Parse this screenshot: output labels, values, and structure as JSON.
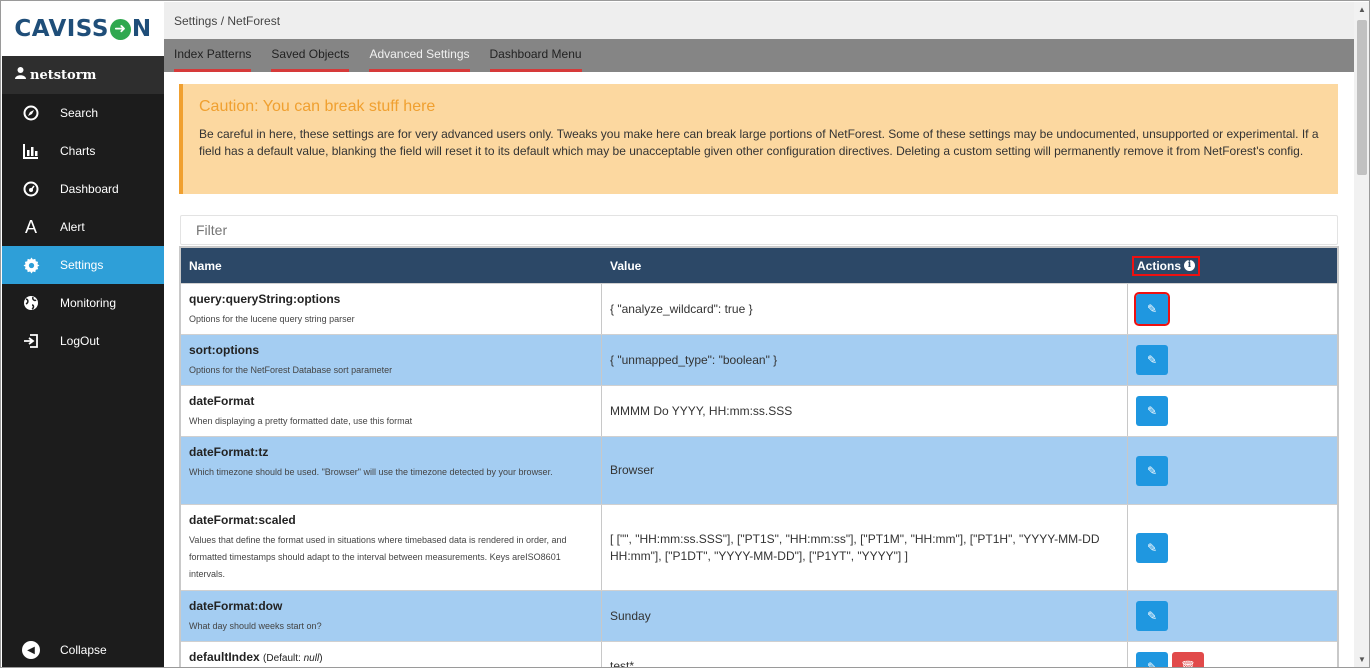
{
  "brand": {
    "logo_text_left": "CAVISS",
    "logo_text_right": "N"
  },
  "sidebar": {
    "user": "netstorm",
    "items": [
      {
        "label": "Search",
        "icon": "compass-icon"
      },
      {
        "label": "Charts",
        "icon": "bar-chart-icon"
      },
      {
        "label": "Dashboard",
        "icon": "dashboard-icon"
      },
      {
        "label": "Alert",
        "icon": "alert-a-icon"
      },
      {
        "label": "Settings",
        "icon": "gear-icon",
        "active": true
      },
      {
        "label": "Monitoring",
        "icon": "globe-icon"
      },
      {
        "label": "LogOut",
        "icon": "logout-icon"
      }
    ],
    "collapse_label": "Collapse"
  },
  "header": {
    "breadcrumb": "Settings / NetForest",
    "tabs": [
      {
        "label": "Index Patterns"
      },
      {
        "label": "Saved Objects"
      },
      {
        "label": "Advanced Settings",
        "active": true
      },
      {
        "label": "Dashboard Menu"
      }
    ]
  },
  "caution": {
    "title": "Caution: You can break stuff here",
    "body": "Be careful in here, these settings are for very advanced users only. Tweaks you make here can break large portions of NetForest. Some of these settings may be undocumented, unsupported or experimental. If a field has a default value, blanking the field will reset it to its default which may be unacceptable given other configuration directives. Deleting a custom setting will permanently remove it from NetForest's config."
  },
  "filter": {
    "placeholder": "Filter"
  },
  "table": {
    "headers": {
      "name": "Name",
      "value": "Value",
      "actions": "Actions"
    },
    "rows": [
      {
        "key": "query:queryString:options",
        "desc": "Options for the lucene query string parser",
        "value": "{ \"analyze_wildcard\": true }"
      },
      {
        "key": "sort:options",
        "desc": "Options for the NetForest Database sort parameter",
        "value": "{ \"unmapped_type\": \"boolean\" }"
      },
      {
        "key": "dateFormat",
        "desc": "When displaying a pretty formatted date, use this format",
        "value": "MMMM Do YYYY, HH:mm:ss.SSS"
      },
      {
        "key": "dateFormat:tz",
        "desc": "Which timezone should be used. \"Browser\" will use the timezone detected by your browser.",
        "value": "Browser"
      },
      {
        "key": "dateFormat:scaled",
        "desc": "Values that define the format used in situations where timebased data is rendered in order, and formatted timestamps should adapt to the interval between measurements. Keys areISO8601 intervals.",
        "value": "[ [\"\", \"HH:mm:ss.SSS\"], [\"PT1S\", \"HH:mm:ss\"], [\"PT1M\", \"HH:mm\"], [\"PT1H\", \"YYYY-MM-DD HH:mm\"], [\"P1DT\", \"YYYY-MM-DD\"], [\"P1YT\", \"YYYY\"] ]"
      },
      {
        "key": "dateFormat:dow",
        "desc": "What day should weeks start on?",
        "value": "Sunday"
      },
      {
        "key": "defaultIndex",
        "default_label": "(Default:",
        "default_value": "null",
        "default_close": ")",
        "desc": "",
        "value": "test*"
      }
    ]
  }
}
